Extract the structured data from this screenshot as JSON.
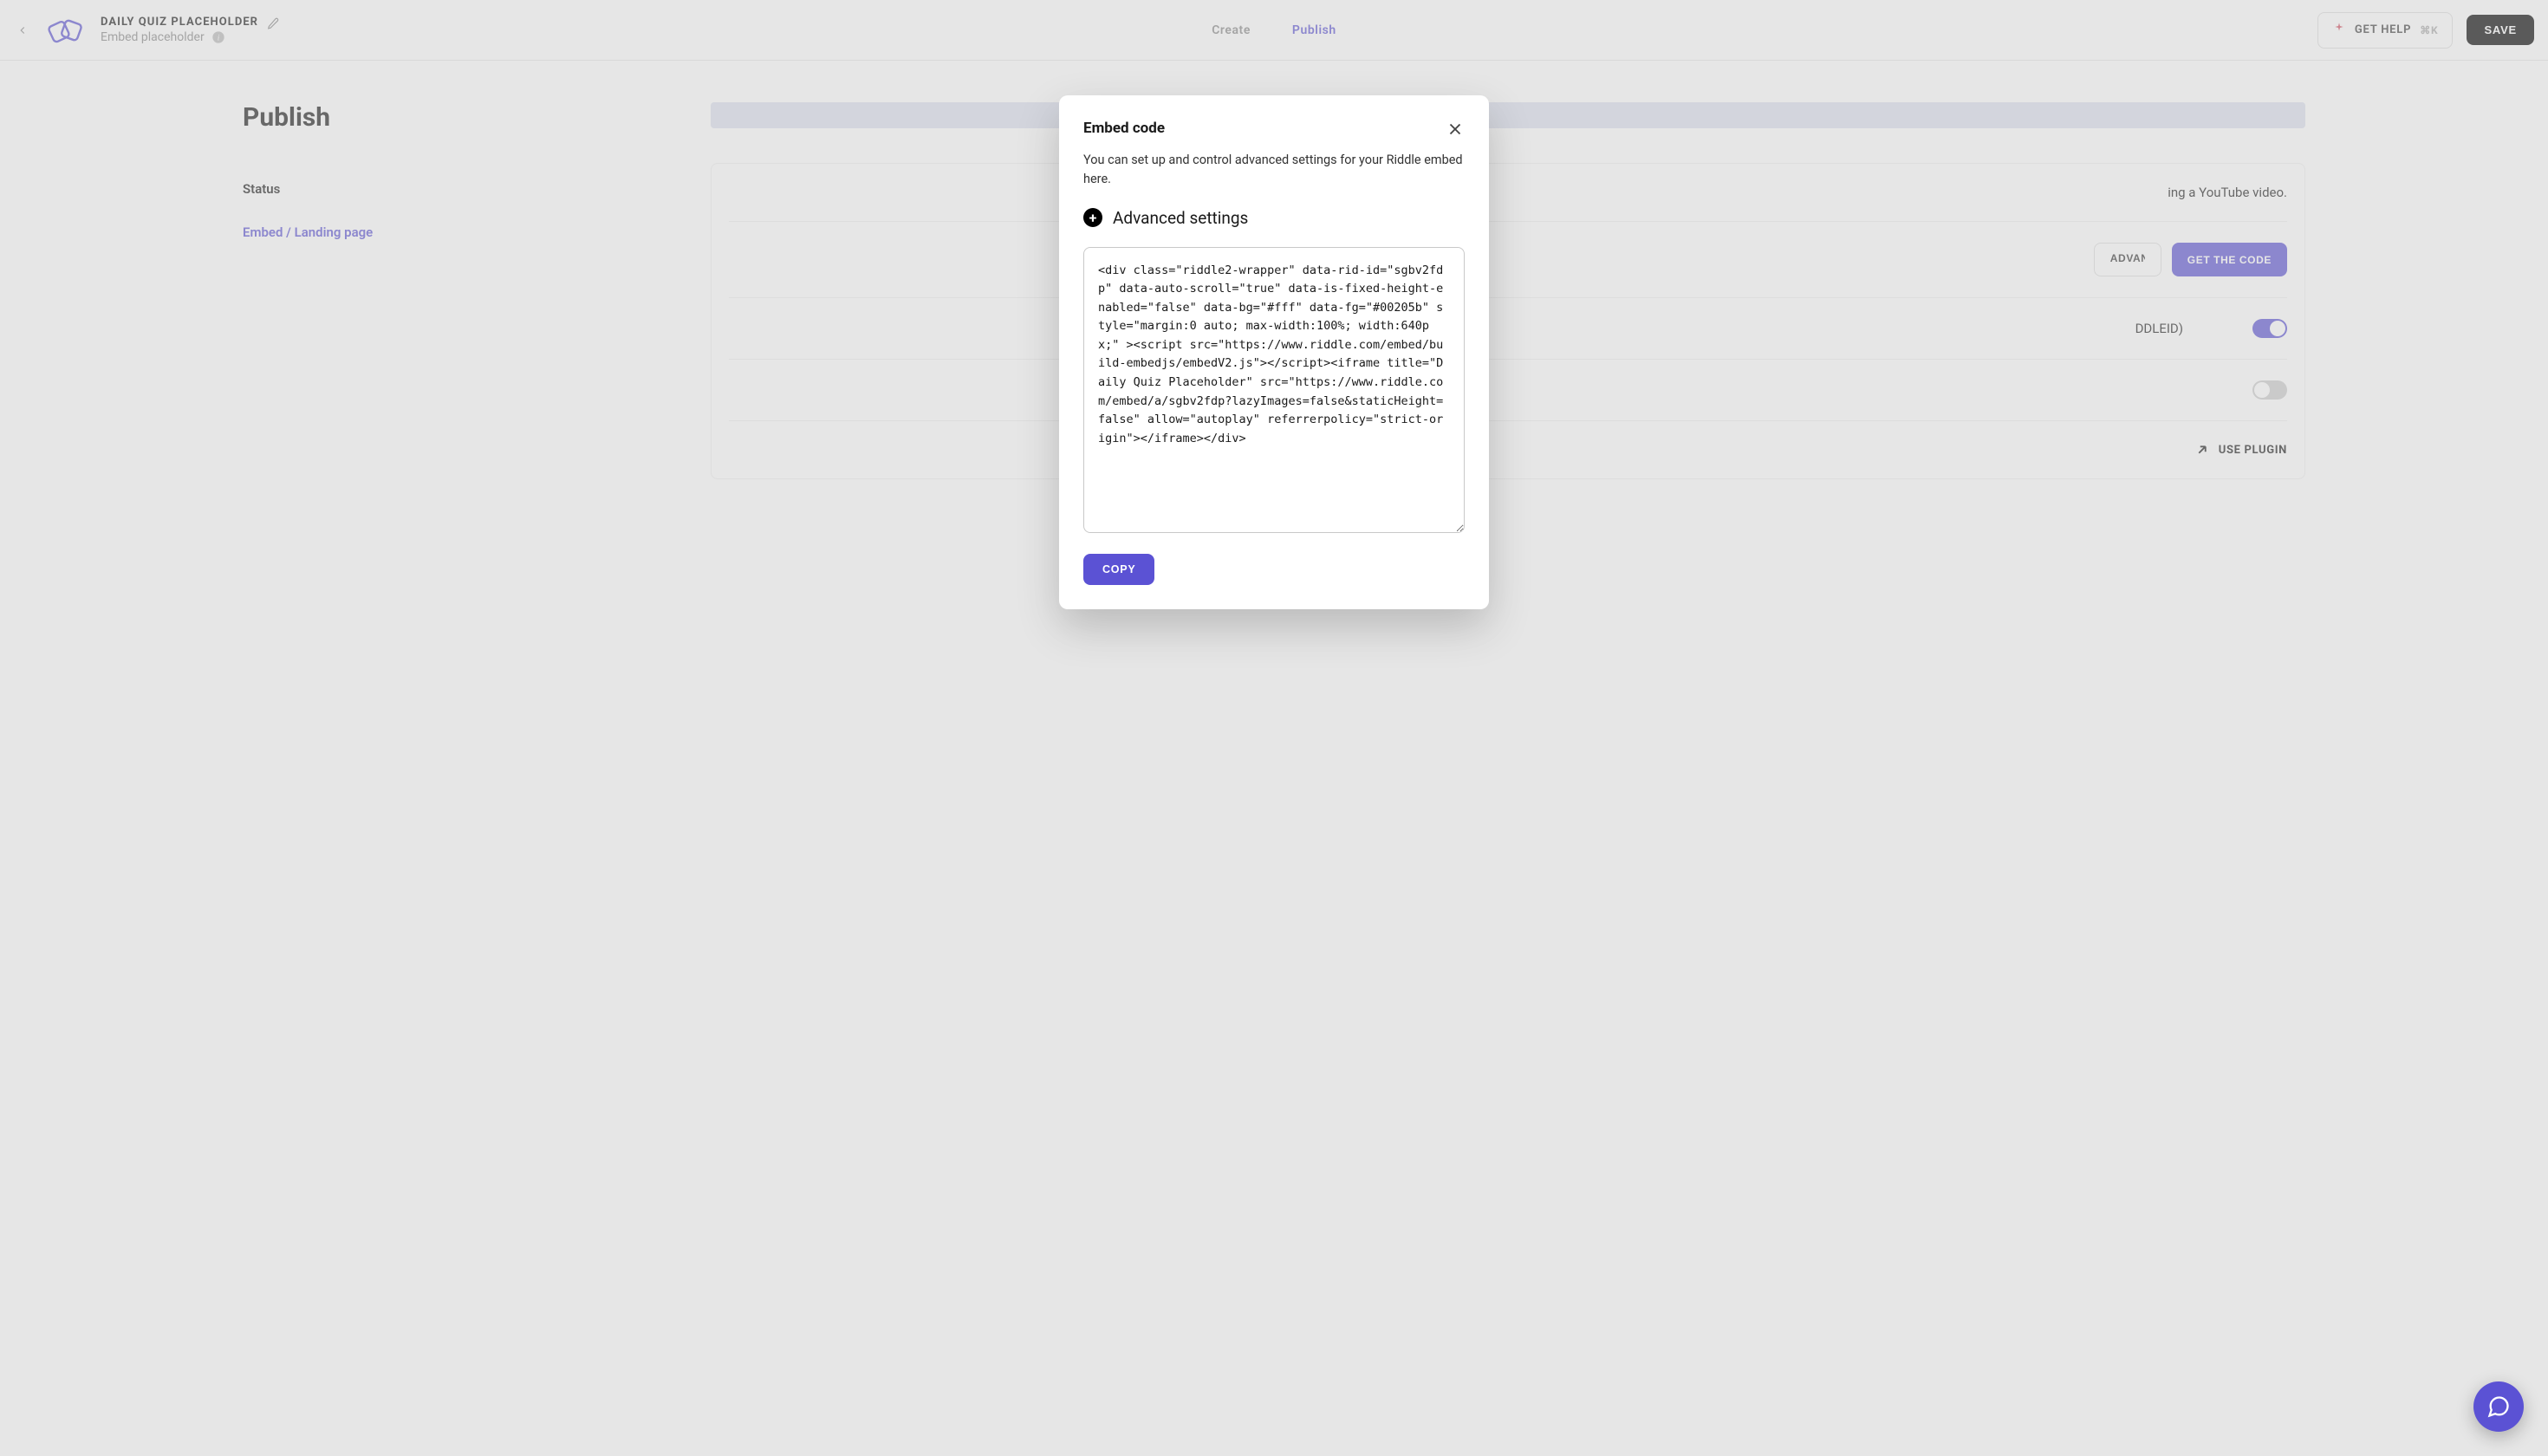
{
  "header": {
    "quiz_title": "DAILY QUIZ PLACEHOLDER",
    "subtitle": "Embed placeholder",
    "tabs": {
      "create": "Create",
      "publish": "Publish"
    },
    "get_help_label": "GET HELP",
    "get_help_shortcut": "⌘K",
    "save_label": "SAVE"
  },
  "sidebar": {
    "page_title": "Publish",
    "links": {
      "status": "Status",
      "embed_landing": "Embed / Landing page"
    }
  },
  "background": {
    "embed_desc_fragment": "ing a YouTube video.",
    "advanced_btn": "ADVANCED",
    "get_code_btn": "GET THE CODE",
    "landing_fragment": "DDLEID)",
    "use_plugin": "USE PLUGIN"
  },
  "modal": {
    "title": "Embed code",
    "description": "You can set up and control advanced settings for your Riddle embed here.",
    "advanced_settings": "Advanced settings",
    "code": "<div class=\"riddle2-wrapper\" data-rid-id=\"sgbv2fdp\" data-auto-scroll=\"true\" data-is-fixed-height-enabled=\"false\" data-bg=\"#fff\" data-fg=\"#00205b\" style=\"margin:0 auto; max-width:100%; width:640px;\" ><script src=\"https://www.riddle.com/embed/build-embedjs/embedV2.js\"></script><iframe title=\"Daily Quiz Placeholder\" src=\"https://www.riddle.com/embed/a/sgbv2fdp?lazyImages=false&staticHeight=false\" allow=\"autoplay\" referrerpolicy=\"strict-origin\"></iframe></div>",
    "copy_label": "COPY"
  }
}
